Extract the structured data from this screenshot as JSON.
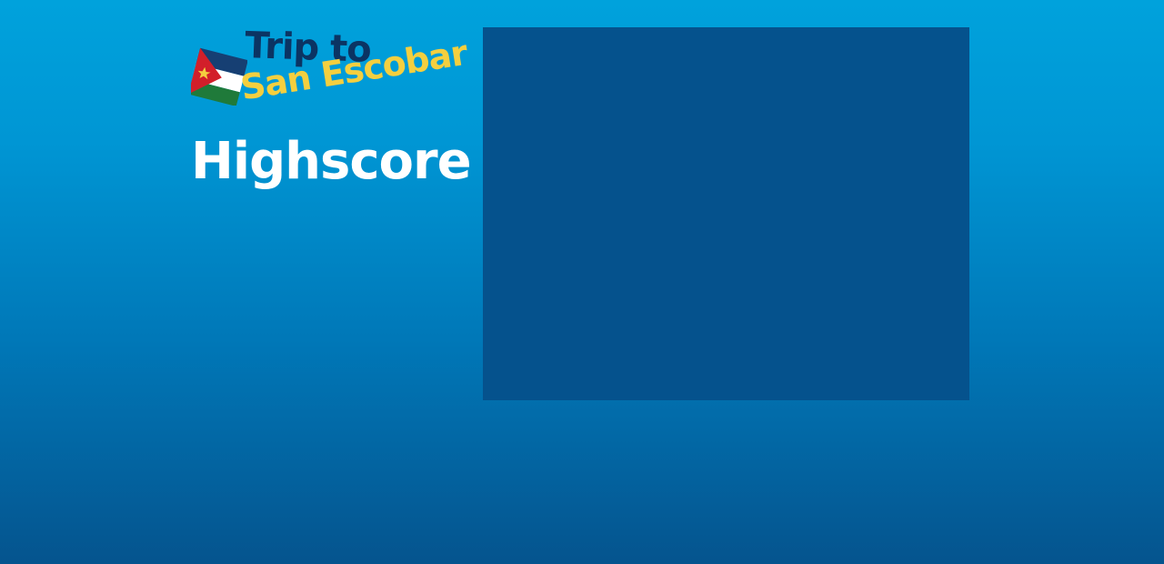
{
  "logo": {
    "line1": "Trip to",
    "line2": "San Escobar",
    "flag_icon": "san-escobar-flag-icon"
  },
  "heading": "Highscore",
  "colors": {
    "background_top": "#00a2dc",
    "background_bottom": "#05548e",
    "panel": "#05528d",
    "title_dark": "#0b3463",
    "title_yellow": "#f4cf3f",
    "heading": "#ffffff"
  }
}
